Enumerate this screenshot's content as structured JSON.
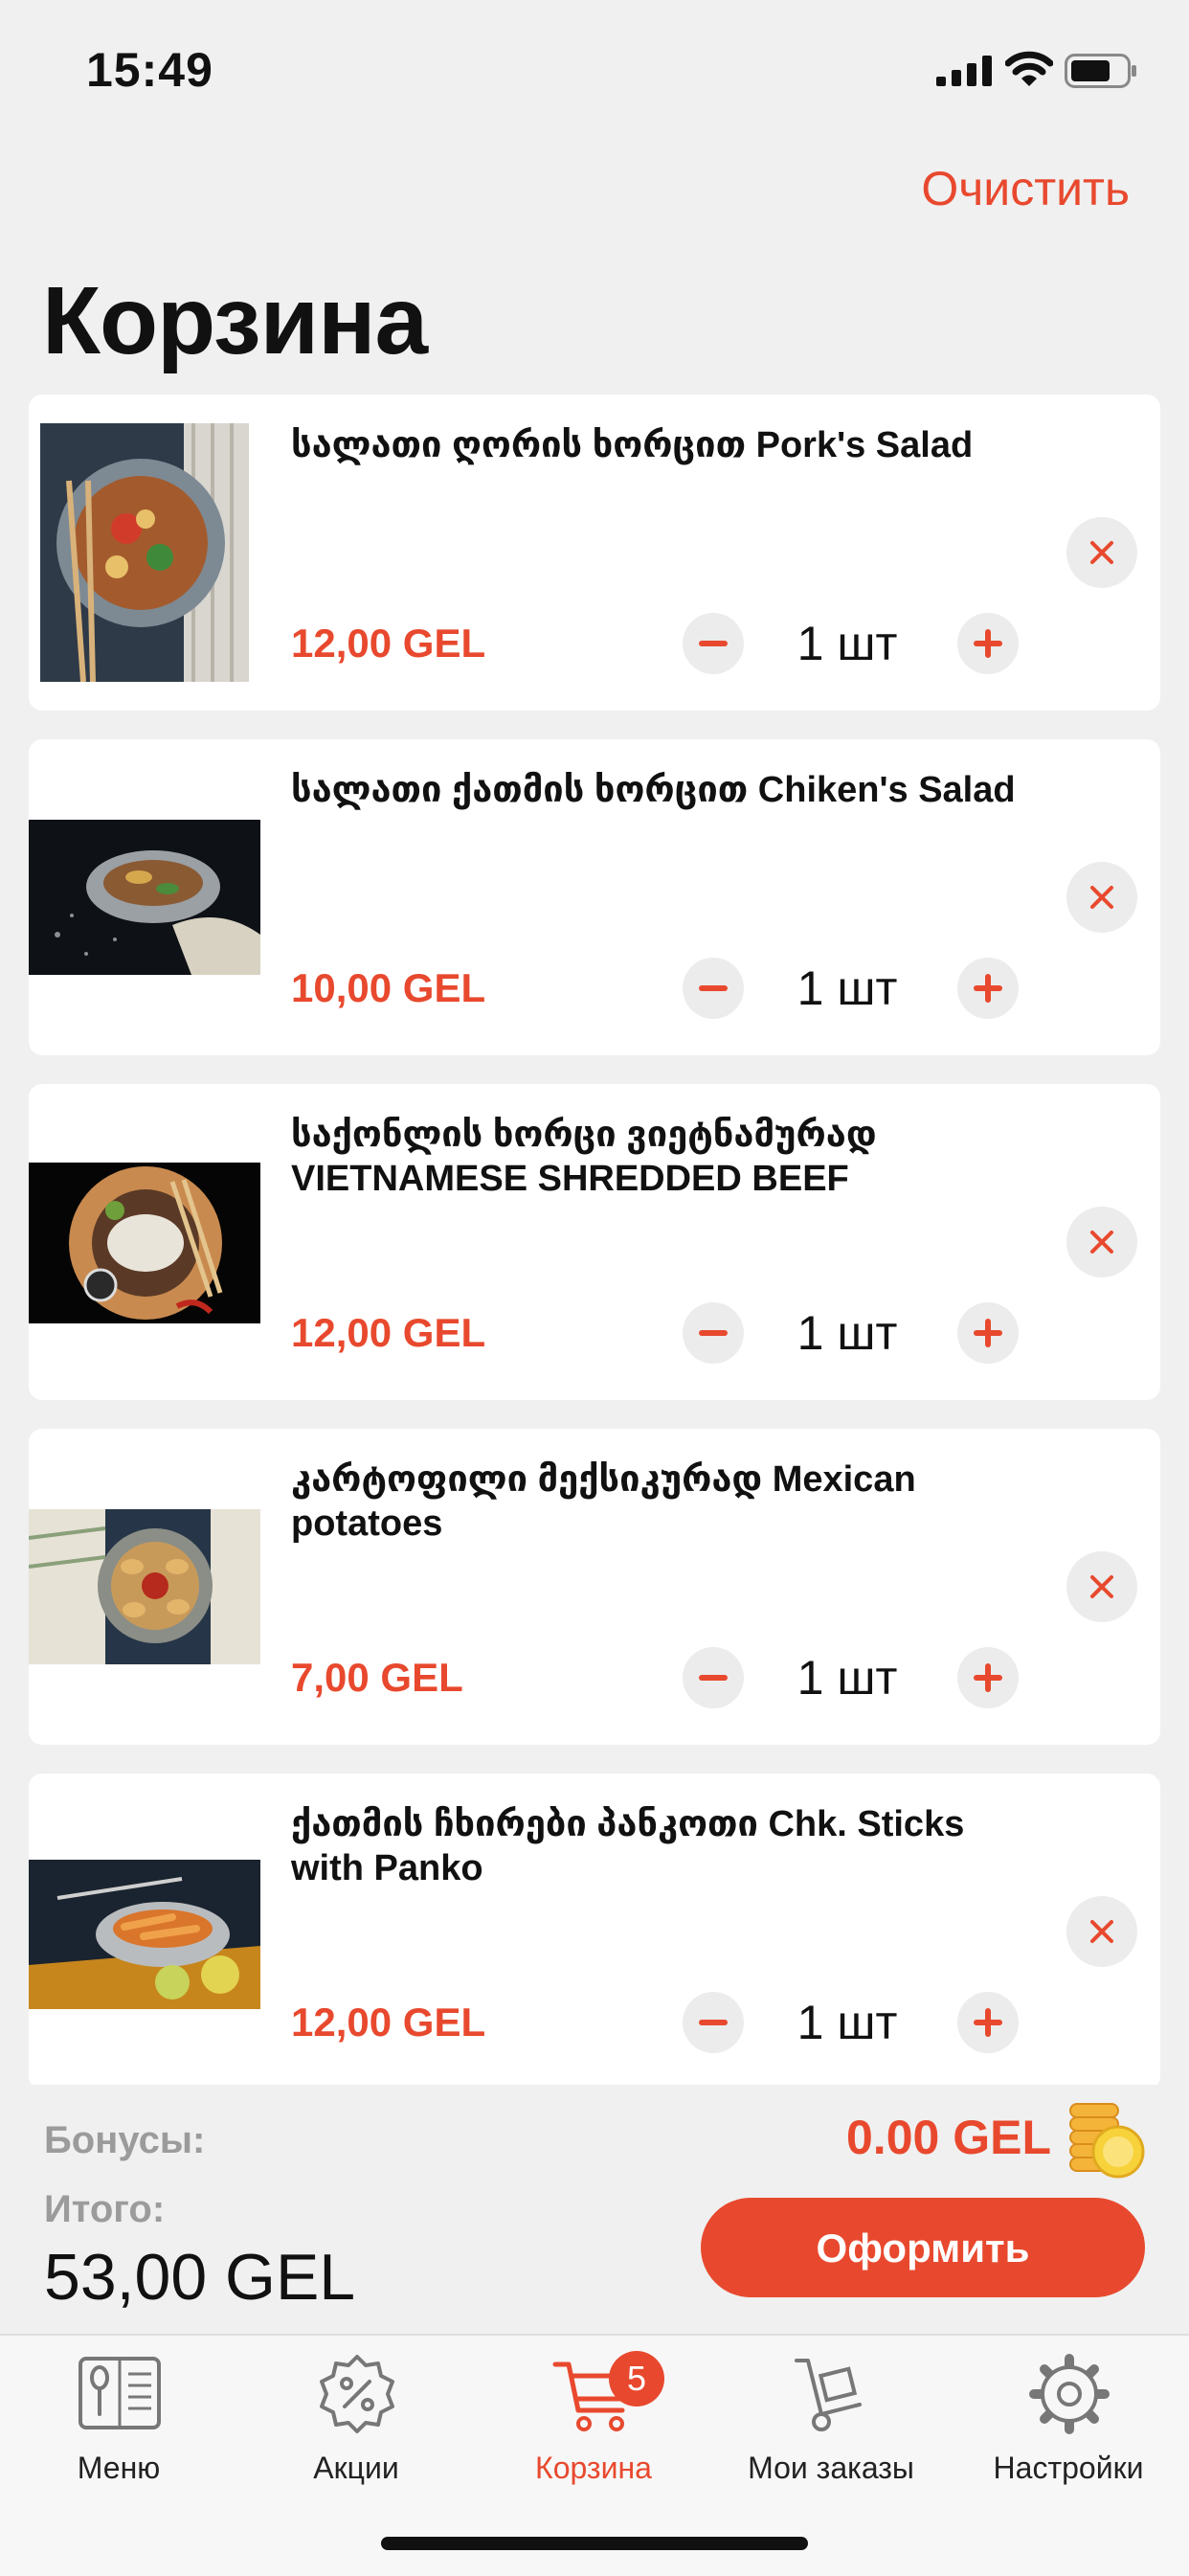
{
  "status_bar": {
    "time": "15:49"
  },
  "header": {
    "clear_label": "Очистить",
    "title": "Корзина"
  },
  "cart_items": [
    {
      "name": "სალათი ღორის ხორცით Pork's Salad",
      "price": "12,00 GEL",
      "qty": "1 шт"
    },
    {
      "name": "სალათი ქათმის ხორცით Chiken's Salad",
      "price": "10,00 GEL",
      "qty": "1 шт"
    },
    {
      "name": "საქონლის ხორცი ვიეტნამურად VIETNAMESE SHREDDED BEEF",
      "price": "12,00 GEL",
      "qty": "1 шт"
    },
    {
      "name": "კარტოფილი მექსიკურად Mexican potatoes",
      "price": "7,00 GEL",
      "qty": "1 шт"
    },
    {
      "name": "ქათმის ჩხირები პანკოთი Chk. Sticks with Panko",
      "price": "12,00 GEL",
      "qty": "1 шт"
    }
  ],
  "summary": {
    "bonus_label": "Бонусы:",
    "bonus_value": "0.00 GEL",
    "total_label": "Итого:",
    "total_value": "53,00 GEL",
    "checkout_label": "Оформить"
  },
  "tabbar": {
    "items": [
      {
        "label": "Меню",
        "icon": "menu-book-icon"
      },
      {
        "label": "Акции",
        "icon": "discount-badge-icon"
      },
      {
        "label": "Корзина",
        "icon": "cart-icon",
        "badge": "5",
        "active": true
      },
      {
        "label": "Мои заказы",
        "icon": "hand-truck-icon"
      },
      {
        "label": "Настройки",
        "icon": "gear-icon"
      }
    ]
  },
  "colors": {
    "accent": "#e8492e",
    "background": "#f0f0f0",
    "card": "#ffffff",
    "muted": "#9b9b9b"
  }
}
